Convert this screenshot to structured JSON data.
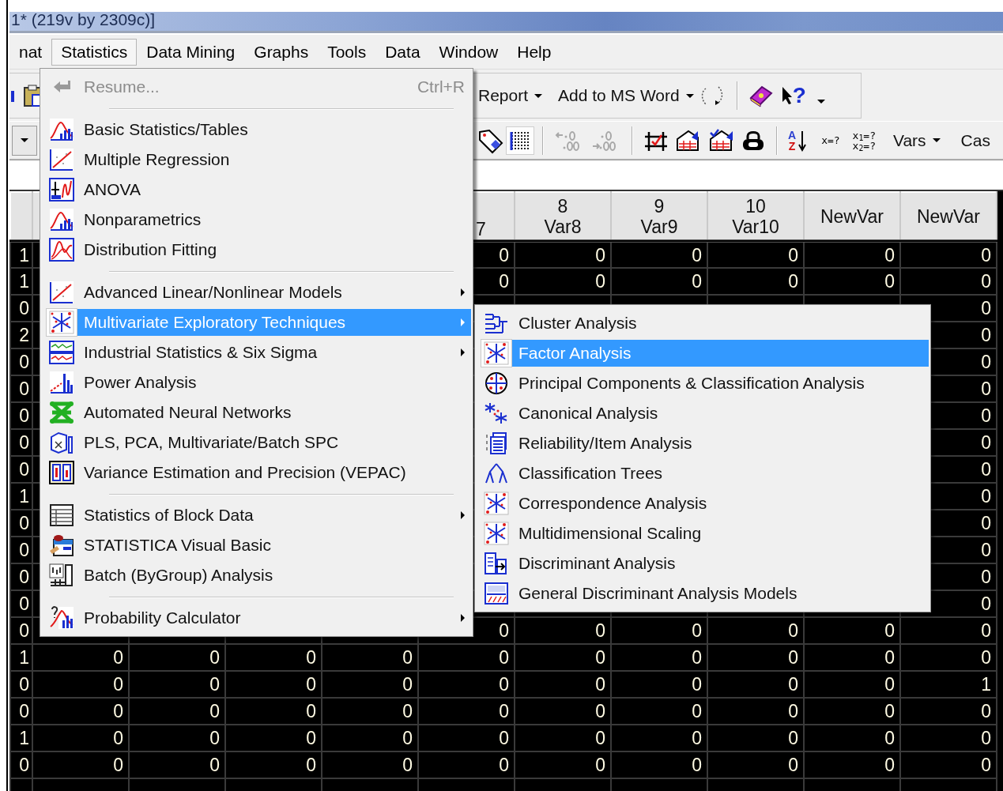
{
  "title_bar": {
    "title": "1* (219v by 2309c)]"
  },
  "menu_bar": [
    {
      "label": "nat",
      "selected": false
    },
    {
      "label": "Statistics",
      "selected": true
    },
    {
      "label": "Data Mining",
      "selected": false
    },
    {
      "label": "Graphs",
      "selected": false
    },
    {
      "label": "Tools",
      "selected": false
    },
    {
      "label": "Data",
      "selected": false
    },
    {
      "label": "Window",
      "selected": false
    },
    {
      "label": "Help",
      "selected": false
    }
  ],
  "toolbar_1": {
    "buttons": [
      {
        "label": "Report",
        "kind": "dropdown"
      },
      {
        "label": "Add to MS Word",
        "kind": "dropdown"
      }
    ],
    "help_glyph": "?"
  },
  "toolbar_2": {
    "grid_button": {
      "pressed": true
    },
    "decimal_buttons": {
      "disabled": true
    },
    "sort_letters": [
      "A",
      "Z"
    ],
    "formula_label": "x=?",
    "multi_formula": [
      "x$_{1}$=?",
      "x$_{2}$=?"
    ],
    "buttons": [
      {
        "label": "Vars",
        "kind": "dropdown"
      },
      {
        "label": "Cas",
        "kind": "plain"
      }
    ]
  },
  "spreadsheet": {
    "columns": [
      null,
      null,
      null,
      null,
      null,
      {
        "name": "7"
      },
      {
        "number": "8",
        "name": "Var8"
      },
      {
        "number": "9",
        "name": "Var9"
      },
      {
        "number": "10",
        "name": "Var10"
      },
      {
        "name": "NewVar"
      },
      {
        "name": "NewVar"
      }
    ],
    "rows": [
      [
        "1",
        null,
        null,
        null,
        null,
        "0",
        "0",
        "0",
        "0",
        "0",
        "0"
      ],
      [
        "1",
        null,
        null,
        null,
        null,
        "0",
        "0",
        "0",
        "0",
        "0",
        "0"
      ],
      [
        "0",
        null,
        null,
        null,
        null,
        null,
        null,
        null,
        null,
        null,
        "0"
      ],
      [
        "2",
        null,
        null,
        null,
        null,
        null,
        null,
        null,
        null,
        null,
        "0"
      ],
      [
        "0",
        null,
        null,
        null,
        null,
        null,
        null,
        null,
        null,
        null,
        "0"
      ],
      [
        "0",
        null,
        null,
        null,
        null,
        null,
        null,
        null,
        null,
        null,
        "0"
      ],
      [
        "0",
        null,
        null,
        null,
        null,
        null,
        null,
        null,
        null,
        null,
        "0"
      ],
      [
        "0",
        null,
        null,
        null,
        null,
        null,
        null,
        null,
        null,
        null,
        "0"
      ],
      [
        "0",
        null,
        null,
        null,
        null,
        null,
        null,
        null,
        null,
        null,
        "0"
      ],
      [
        "1",
        null,
        null,
        null,
        null,
        null,
        null,
        null,
        null,
        null,
        "0"
      ],
      [
        "0",
        null,
        null,
        null,
        null,
        null,
        null,
        null,
        null,
        null,
        "0"
      ],
      [
        "0",
        null,
        null,
        null,
        null,
        null,
        null,
        null,
        null,
        null,
        "0"
      ],
      [
        "0",
        null,
        null,
        null,
        null,
        null,
        null,
        null,
        null,
        null,
        "0"
      ],
      [
        "0",
        null,
        null,
        null,
        null,
        null,
        null,
        null,
        null,
        null,
        "0"
      ],
      [
        "0",
        null,
        null,
        null,
        null,
        "0",
        "0",
        "0",
        "0",
        "0",
        "0"
      ],
      [
        "1",
        "0",
        "0",
        "0",
        "0",
        "0",
        "0",
        "0",
        "0",
        "0",
        "0"
      ],
      [
        "0",
        "0",
        "0",
        "0",
        "0",
        "0",
        "0",
        "0",
        "0",
        "0",
        "1"
      ],
      [
        "0",
        "0",
        "0",
        "0",
        "0",
        "0",
        "0",
        "0",
        "0",
        "0",
        "0"
      ],
      [
        "1",
        "0",
        "0",
        "0",
        "0",
        "0",
        "0",
        "0",
        "0",
        "0",
        "0"
      ],
      [
        "0",
        "0",
        "0",
        "0",
        "0",
        "0",
        "0",
        "0",
        "0",
        "0",
        "0"
      ]
    ]
  },
  "statistics_menu": {
    "items": [
      {
        "kind": "item",
        "label": "Resume...",
        "shortcut": "Ctrl+R",
        "disabled": true,
        "submenu": false,
        "selected": false
      },
      {
        "kind": "separator"
      },
      {
        "kind": "item",
        "label": "Basic Statistics/Tables",
        "disabled": false,
        "submenu": false,
        "selected": false
      },
      {
        "kind": "item",
        "label": "Multiple Regression",
        "disabled": false,
        "submenu": false,
        "selected": false
      },
      {
        "kind": "item",
        "label": "ANOVA",
        "disabled": false,
        "submenu": false,
        "selected": false
      },
      {
        "kind": "item",
        "label": "Nonparametrics",
        "disabled": false,
        "submenu": false,
        "selected": false
      },
      {
        "kind": "item",
        "label": "Distribution Fitting",
        "disabled": false,
        "submenu": false,
        "selected": false
      },
      {
        "kind": "separator"
      },
      {
        "kind": "item",
        "label": "Advanced Linear/Nonlinear Models",
        "disabled": false,
        "submenu": true,
        "selected": false
      },
      {
        "kind": "item",
        "label": "Multivariate Exploratory Techniques",
        "disabled": false,
        "submenu": true,
        "selected": true
      },
      {
        "kind": "item",
        "label": "Industrial Statistics & Six Sigma",
        "disabled": false,
        "submenu": true,
        "selected": false
      },
      {
        "kind": "item",
        "label": "Power Analysis",
        "disabled": false,
        "submenu": false,
        "selected": false
      },
      {
        "kind": "item",
        "label": "Automated Neural Networks",
        "disabled": false,
        "submenu": false,
        "selected": false
      },
      {
        "kind": "item",
        "label": "PLS, PCA, Multivariate/Batch SPC",
        "disabled": false,
        "submenu": false,
        "selected": false
      },
      {
        "kind": "item",
        "label": "Variance Estimation and Precision (VEPAC)",
        "disabled": false,
        "submenu": false,
        "selected": false
      },
      {
        "kind": "separator"
      },
      {
        "kind": "item",
        "label": "Statistics of Block Data",
        "disabled": false,
        "submenu": true,
        "selected": false
      },
      {
        "kind": "item",
        "label": "STATISTICA Visual Basic",
        "disabled": false,
        "submenu": false,
        "selected": false
      },
      {
        "kind": "item",
        "label": "Batch (ByGroup) Analysis",
        "disabled": false,
        "submenu": false,
        "selected": false
      },
      {
        "kind": "separator"
      },
      {
        "kind": "item",
        "label": "Probability Calculator",
        "disabled": false,
        "submenu": true,
        "selected": false
      }
    ]
  },
  "multivariate_submenu": {
    "items": [
      {
        "label": "Cluster Analysis",
        "selected": false
      },
      {
        "label": "Factor Analysis",
        "selected": true
      },
      {
        "label": "Principal Components & Classification Analysis",
        "selected": false
      },
      {
        "label": "Canonical Analysis",
        "selected": false
      },
      {
        "label": "Reliability/Item Analysis",
        "selected": false
      },
      {
        "label": "Classification Trees",
        "selected": false
      },
      {
        "label": "Correspondence Analysis",
        "selected": false
      },
      {
        "label": "Multidimensional Scaling",
        "selected": false
      },
      {
        "label": "Discriminant Analysis",
        "selected": false
      },
      {
        "label": "General Discriminant Analysis Models",
        "selected": false
      }
    ]
  }
}
